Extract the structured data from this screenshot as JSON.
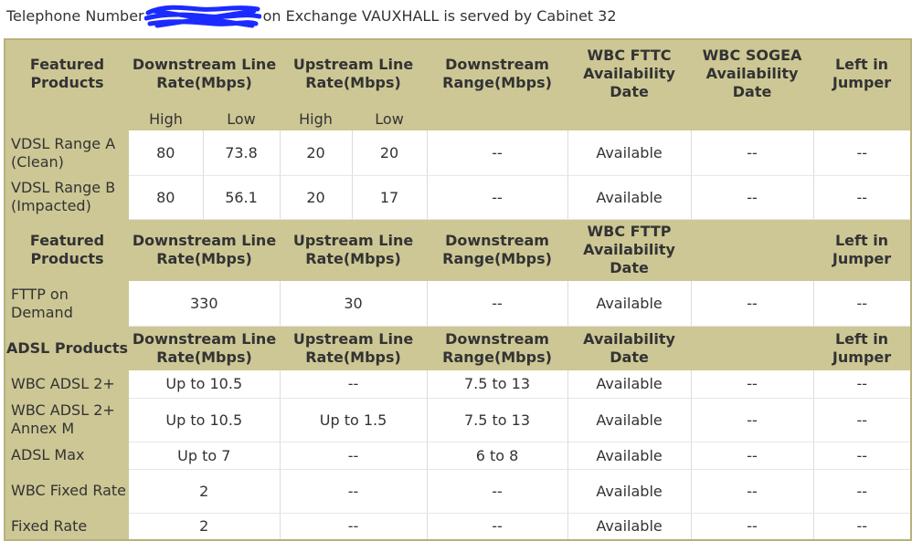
{
  "header": {
    "prefix": "Telephone Number",
    "suffix": "on Exchange VAUXHALL is served by Cabinet 32"
  },
  "table": {
    "fttc_header": {
      "featured": "Featured Products",
      "down_rate": "Downstream Line Rate(Mbps)",
      "up_rate": "Upstream Line Rate(Mbps)",
      "down_range": "Downstream Range(Mbps)",
      "wbc_fttc": "WBC FTTC Availability Date",
      "wbc_sogea": "WBC SOGEA Availability Date",
      "left_jumper": "Left in Jumper"
    },
    "subheader": {
      "high1": "High",
      "low1": "Low",
      "high2": "High",
      "low2": "Low"
    },
    "vdsl_rows": [
      {
        "name": "VDSL Range A (Clean)",
        "down_high": "80",
        "down_low": "73.8",
        "up_high": "20",
        "up_low": "20",
        "range": "--",
        "fttc": "Available",
        "sogea": "--",
        "jumper": "--"
      },
      {
        "name": "VDSL Range B (Impacted)",
        "down_high": "80",
        "down_low": "56.1",
        "up_high": "20",
        "up_low": "17",
        "range": "--",
        "fttc": "Available",
        "sogea": "--",
        "jumper": "--"
      }
    ],
    "fttp_header": {
      "featured": "Featured Products",
      "down_rate": "Downstream Line Rate(Mbps)",
      "up_rate": "Upstream Line Rate(Mbps)",
      "down_range": "Downstream Range(Mbps)",
      "wbc_fttp": "WBC FTTP Availability Date",
      "blank": "",
      "left_jumper": "Left in Jumper"
    },
    "fttp_row": {
      "name": "FTTP on Demand",
      "down": "330",
      "up": "30",
      "range": "--",
      "avail": "Available",
      "extra": "--",
      "jumper": "--"
    },
    "adsl_header": {
      "products": "ADSL Products",
      "down_rate": "Downstream Line Rate(Mbps)",
      "up_rate": "Upstream Line Rate(Mbps)",
      "down_range": "Downstream Range(Mbps)",
      "avail_date": "Availability Date",
      "blank": "",
      "left_jumper": "Left in Jumper"
    },
    "adsl_rows": [
      {
        "name": "WBC ADSL 2+",
        "down": "Up to 10.5",
        "up": "--",
        "range": "7.5 to 13",
        "avail": "Available",
        "extra": "--",
        "jumper": "--"
      },
      {
        "name": "WBC ADSL 2+ Annex M",
        "down": "Up to 10.5",
        "up": "Up to 1.5",
        "range": "7.5 to 13",
        "avail": "Available",
        "extra": "--",
        "jumper": "--"
      },
      {
        "name": "ADSL Max",
        "down": "Up to 7",
        "up": "--",
        "range": "6 to 8",
        "avail": "Available",
        "extra": "--",
        "jumper": "--"
      },
      {
        "name": "WBC Fixed Rate",
        "down": "2",
        "up": "--",
        "range": "--",
        "avail": "Available",
        "extra": "--",
        "jumper": "--"
      },
      {
        "name": "Fixed Rate",
        "down": "2",
        "up": "--",
        "range": "--",
        "avail": "Available",
        "extra": "--",
        "jumper": "--"
      }
    ]
  }
}
